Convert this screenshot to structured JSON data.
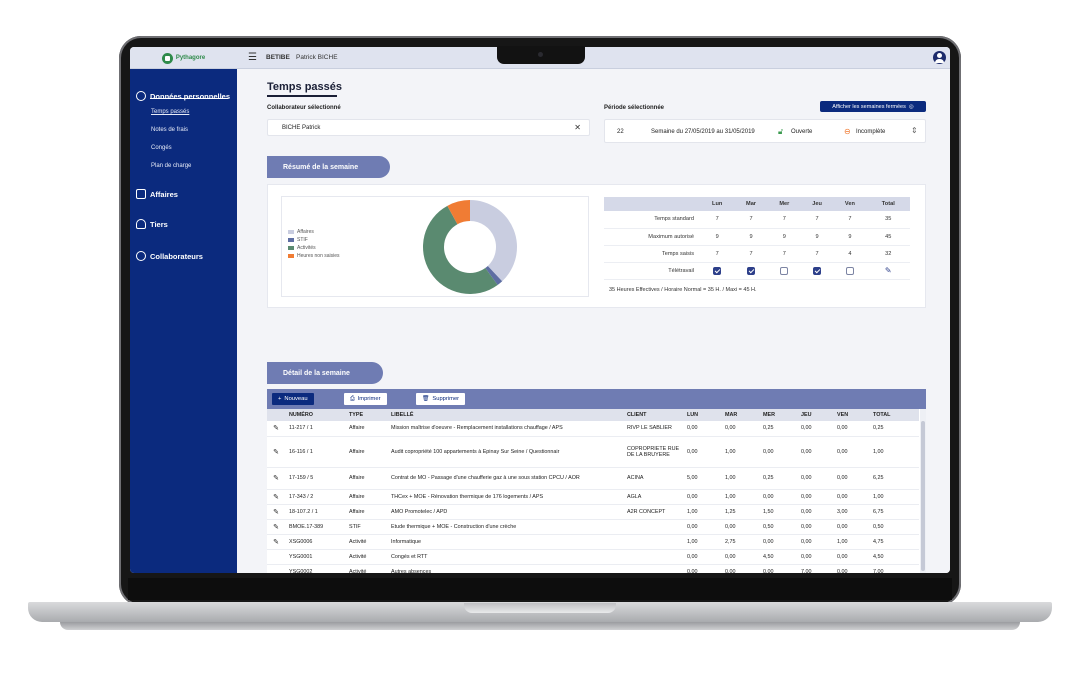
{
  "header": {
    "logo_text": "Pythagore",
    "company": "BETIBE",
    "user": "Patrick BICHE"
  },
  "sidebar": {
    "sections": [
      {
        "label": "Données personnelles",
        "icon": "users-icon"
      },
      {
        "label": "Affaires",
        "icon": "document-icon"
      },
      {
        "label": "Tiers",
        "icon": "people-icon"
      },
      {
        "label": "Collaborateurs",
        "icon": "user-circle-icon"
      }
    ],
    "sub_items": [
      "Temps passés",
      "Notes de frais",
      "Congés",
      "Plan de charge"
    ]
  },
  "page": {
    "title": "Temps passés"
  },
  "collaborator": {
    "label": "Collaborateur sélectionné",
    "value": "BICHE Patrick"
  },
  "period": {
    "label": "Période sélectionnée",
    "week_number": "22",
    "week_text": "Semaine du 27/05/2019 au 31/05/2019",
    "status_open": "Ouverte",
    "status_incomplete": "Incomplète",
    "closed_weeks_button": "Afficher les semaines fermées"
  },
  "summary": {
    "pill": "Résumé de la semaine",
    "legend": [
      {
        "label": "Affaires",
        "color": "#c9cde0"
      },
      {
        "label": "STIF",
        "color": "#5e6ea3"
      },
      {
        "label": "Activités",
        "color": "#5a8a70"
      },
      {
        "label": "Heures non saisies",
        "color": "#f07c34"
      }
    ],
    "headers": [
      "Lun",
      "Mar",
      "Mer",
      "Jeu",
      "Ven",
      "Total"
    ],
    "rows": [
      {
        "label": "Temps standard",
        "values": [
          "7",
          "7",
          "7",
          "7",
          "7",
          "35"
        ]
      },
      {
        "label": "Maximum autorisé",
        "values": [
          "9",
          "9",
          "9",
          "9",
          "9",
          "45"
        ]
      },
      {
        "label": "Temps saisis",
        "values": [
          "7",
          "7",
          "7",
          "7",
          "4",
          "32"
        ]
      }
    ],
    "telework_label": "Télétravail",
    "telework": [
      true,
      true,
      false,
      true,
      false
    ],
    "note": "35 Heures Effectives / Horaire Normal = 35 H. / Maxi = 45 H."
  },
  "chart_data": {
    "type": "pie",
    "categories": [
      "Affaires",
      "STIF",
      "Activités",
      "Heures non saisies"
    ],
    "values": [
      38,
      2,
      52,
      8
    ],
    "colors": [
      "#c9cde0",
      "#5e6ea3",
      "#5a8a70",
      "#f07c34"
    ],
    "legend": "left"
  },
  "detail": {
    "pill": "Détail de la semaine",
    "buttons": {
      "new": "Nouveau",
      "print": "Imprimer",
      "delete": "Supprimer"
    },
    "columns": [
      "NUMÉRO",
      "TYPE",
      "LIBELLÉ",
      "CLIENT",
      "LUN",
      "MAR",
      "MER",
      "JEU",
      "VEN",
      "TOTAL"
    ],
    "rows": [
      {
        "edit": true,
        "cells": [
          "11-217 / 1",
          "Affaire",
          "Mission maîtrise d'oeuvre - Remplacement installations chauffage / APS",
          "RIVP LE SABLIER",
          "0,00",
          "0,00",
          "0,25",
          "0,00",
          "0,00",
          "0,25"
        ]
      },
      {
        "edit": true,
        "cells": [
          "16-116 / 1",
          "Affaire",
          "Audit copropriété 100 appartements à Epinay Sur Seine / Questionnair",
          "COPROPRIETE RUE DE LA BRUYERE",
          "0,00",
          "1,00",
          "0,00",
          "0,00",
          "0,00",
          "1,00"
        ]
      },
      {
        "edit": true,
        "cells": [
          "17-159 / 5",
          "Affaire",
          "Contrat de MO - Passage d'une chaufferie gaz à une sous station CPCU / AOR",
          "ACINA",
          "5,00",
          "1,00",
          "0,25",
          "0,00",
          "0,00",
          "6,25"
        ]
      },
      {
        "edit": true,
        "cells": [
          "17-343 / 2",
          "Affaire",
          "THCex + MOE - Rénovation thermique de 176 logements / APS",
          "AGLA",
          "0,00",
          "1,00",
          "0,00",
          "0,00",
          "0,00",
          "1,00"
        ]
      },
      {
        "edit": true,
        "cells": [
          "18-107.2 / 1",
          "Affaire",
          "AMO Promotelec / APD",
          "A2R CONCEPT",
          "1,00",
          "1,25",
          "1,50",
          "0,00",
          "3,00",
          "6,75"
        ]
      },
      {
        "edit": true,
        "cells": [
          "BMOE.17-389",
          "STIF",
          "Etude thermique + MOE - Construction d'une crèche",
          "",
          "0,00",
          "0,00",
          "0,50",
          "0,00",
          "0,00",
          "0,50"
        ]
      },
      {
        "edit": true,
        "cells": [
          "XSG0006",
          "Activité",
          "Informatique",
          "",
          "1,00",
          "2,75",
          "0,00",
          "0,00",
          "1,00",
          "4,75"
        ]
      },
      {
        "edit": false,
        "cells": [
          "YSG0001",
          "Activité",
          "Congés et RTT",
          "",
          "0,00",
          "0,00",
          "4,50",
          "0,00",
          "0,00",
          "4,50"
        ]
      },
      {
        "edit": false,
        "cells": [
          "YSG0002",
          "Activité",
          "Autres absences",
          "",
          "0.00",
          "0.00",
          "0.00",
          "7.00",
          "0.00",
          "7.00"
        ]
      }
    ]
  }
}
